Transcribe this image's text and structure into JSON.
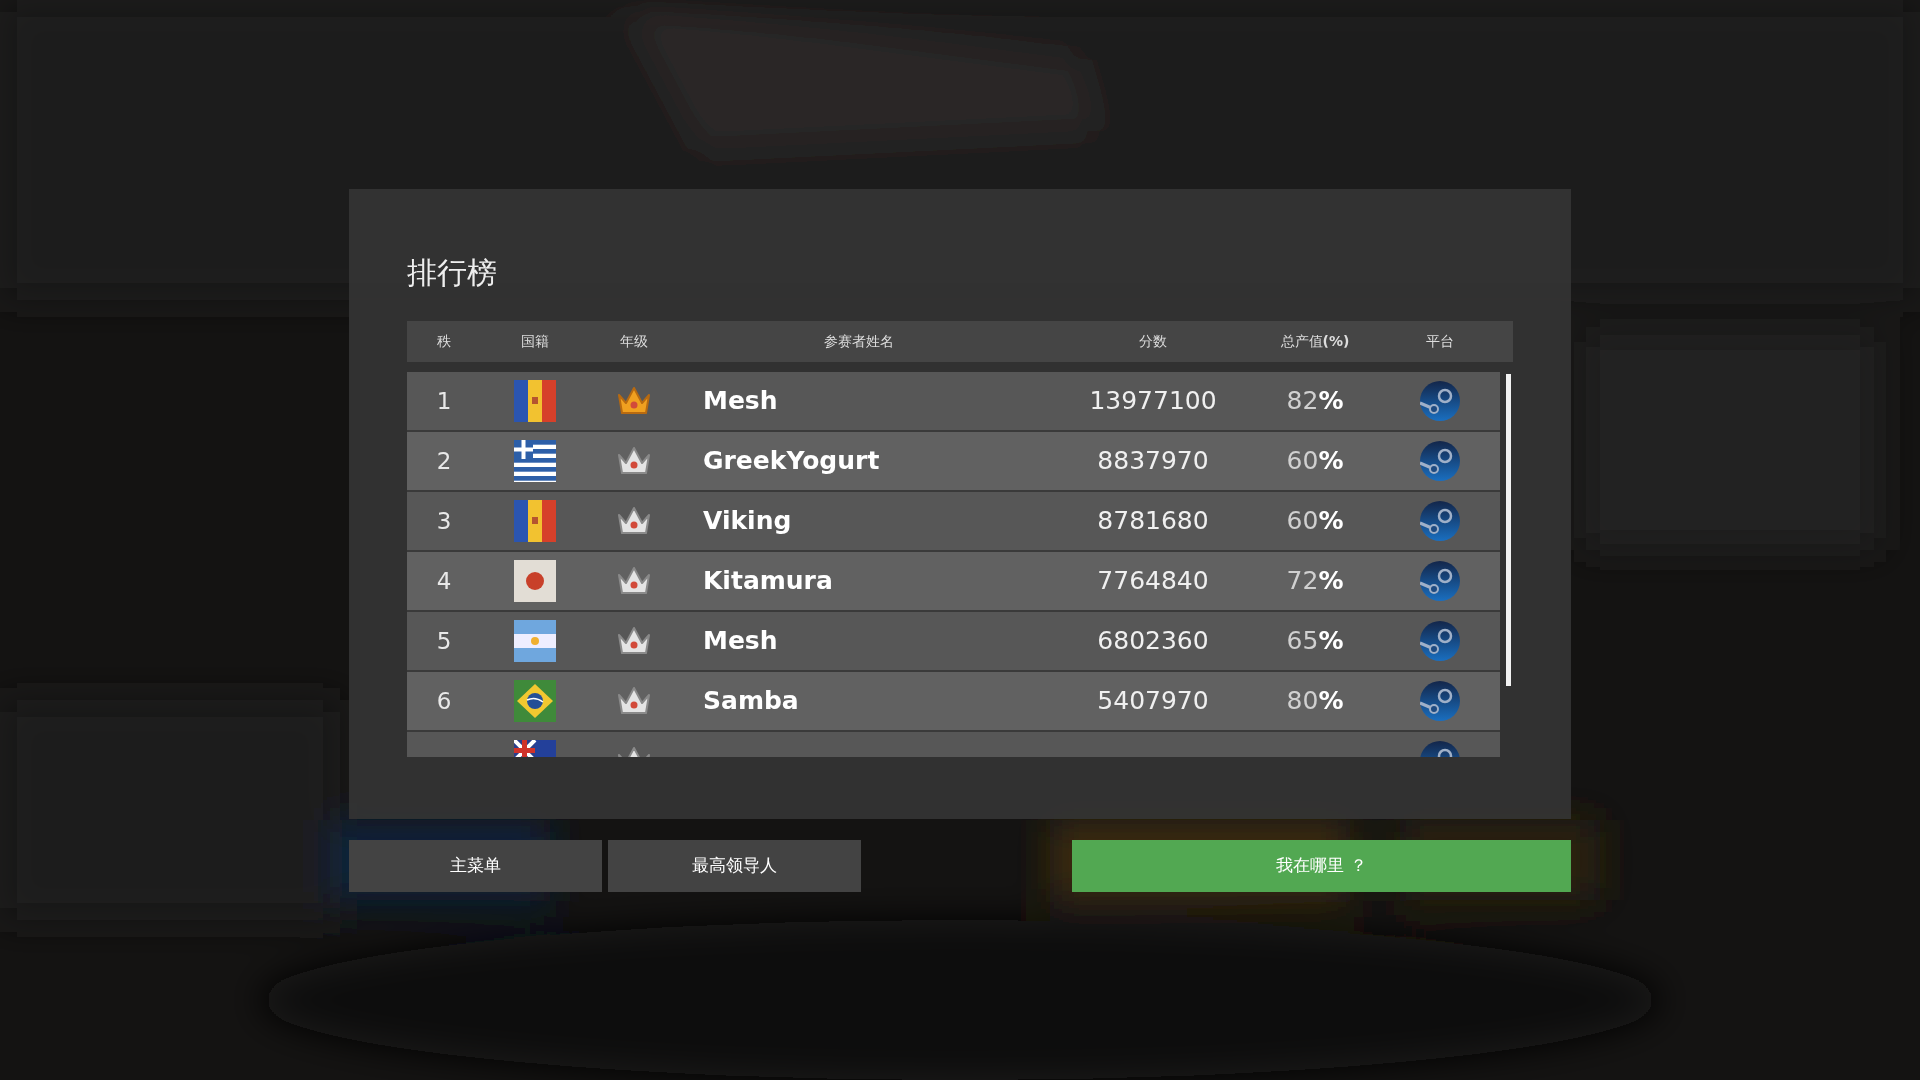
{
  "title": "排行榜",
  "columns": [
    "秩",
    "国籍",
    "年级",
    "参赛者姓名",
    "分数",
    "总产值**(%)**",
    "平台"
  ],
  "rows": [
    {
      "rank": "1",
      "flag": {
        "kind": "andorra"
      },
      "gold_crown": true,
      "name": "Mesh",
      "score": "13977100",
      "percent": "82**%**"
    },
    {
      "rank": "2",
      "flag": {
        "kind": "greece"
      },
      "gold_crown": false,
      "name": "GreekYogurt",
      "score": "8837970",
      "percent": "60**%**"
    },
    {
      "rank": "3",
      "flag": {
        "kind": "andorra"
      },
      "gold_crown": false,
      "name": "Viking",
      "score": "8781680",
      "percent": "60**%**"
    },
    {
      "rank": "4",
      "flag": {
        "kind": "japan"
      },
      "gold_crown": false,
      "name": "Kitamura",
      "score": "7764840",
      "percent": "72**%**"
    },
    {
      "rank": "5",
      "flag": {
        "kind": "argentina"
      },
      "gold_crown": false,
      "name": "Mesh",
      "score": "6802360",
      "percent": "65**%**"
    },
    {
      "rank": "6",
      "flag": {
        "kind": "brazil"
      },
      "gold_crown": false,
      "name": "Samba",
      "score": "5407970",
      "percent": "80**%**"
    },
    {
      "flag": {
        "kind": "uk"
      },
      "gold_crown": false
    }
  ],
  "buttons": [
    {
      "label": "主菜单",
      "kind": "dark"
    },
    {
      "label": "最高领导人",
      "kind": "dark"
    },
    {
      "label": "我在哪里 ？",
      "kind": "green"
    }
  ]
}
